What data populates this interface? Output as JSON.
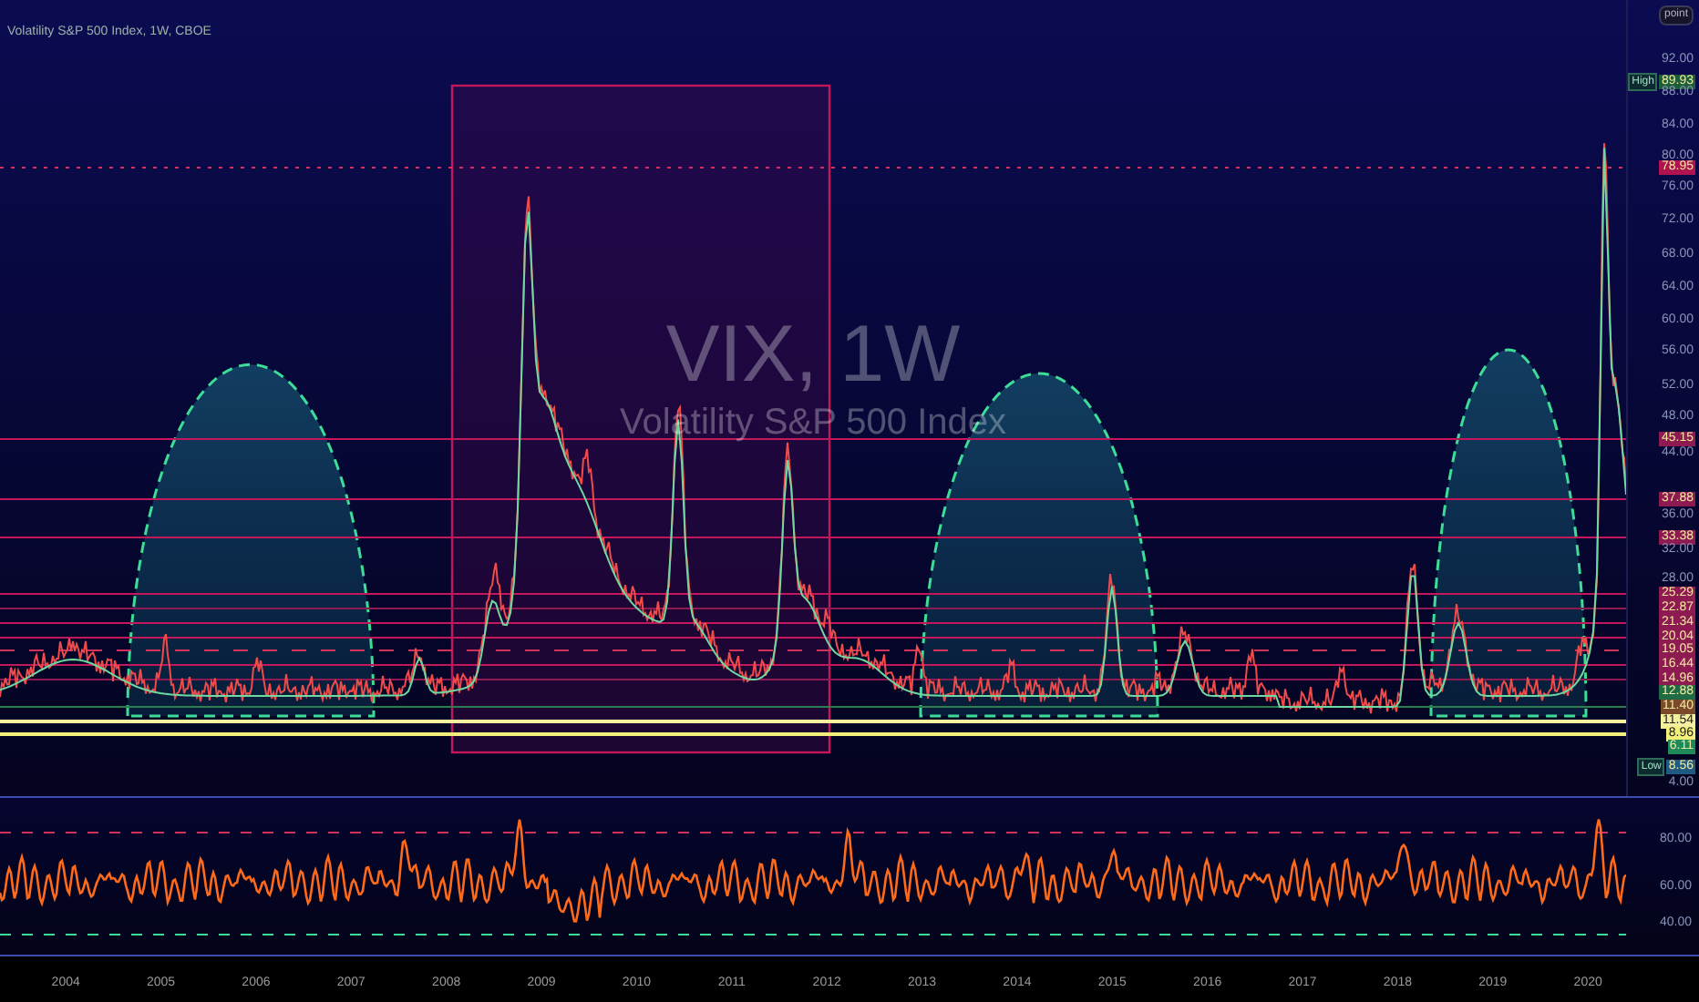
{
  "header": {
    "title": "Volatility S&P 500 Index, 1W, CBOE",
    "button": "point"
  },
  "watermark": {
    "symbol": "VIX, 1W",
    "name": "Volatility S&P 500 Index"
  },
  "price_axis": {
    "labels": [
      {
        "text": "92.00",
        "kind": "tick"
      },
      {
        "text": "89.93",
        "kind": "badge",
        "name": "High",
        "color": "#1b5e3a"
      },
      {
        "text": "88.00",
        "kind": "tick"
      },
      {
        "text": "84.00",
        "kind": "tick"
      },
      {
        "text": "80.00",
        "kind": "tick"
      },
      {
        "text": "78.95",
        "kind": "badge",
        "color": "#b0134f"
      },
      {
        "text": "76.00",
        "kind": "tick"
      },
      {
        "text": "72.00",
        "kind": "tick"
      },
      {
        "text": "68.00",
        "kind": "tick"
      },
      {
        "text": "64.00",
        "kind": "tick"
      },
      {
        "text": "60.00",
        "kind": "tick"
      },
      {
        "text": "56.00",
        "kind": "tick"
      },
      {
        "text": "52.00",
        "kind": "tick"
      },
      {
        "text": "48.00",
        "kind": "tick"
      },
      {
        "text": "45.15",
        "kind": "badge",
        "color": "#8e1a52"
      },
      {
        "text": "44.00",
        "kind": "tick"
      },
      {
        "text": "37.88",
        "kind": "badge",
        "color": "#8e1a52"
      },
      {
        "text": "36.00",
        "kind": "tick"
      },
      {
        "text": "33.38",
        "kind": "badge",
        "color": "#8e1a52"
      },
      {
        "text": "32.00",
        "kind": "tick"
      },
      {
        "text": "28.00",
        "kind": "tick"
      },
      {
        "text": "25.29",
        "kind": "badge",
        "color": "#8e1a52"
      },
      {
        "text": "22.87",
        "kind": "badge",
        "color": "#8e1a52"
      },
      {
        "text": "21.34",
        "kind": "badge",
        "color": "#8e1a52"
      },
      {
        "text": "20.04",
        "kind": "badge",
        "color": "#8e1a52"
      },
      {
        "text": "19.05",
        "kind": "badge",
        "color": "#8e1a52"
      },
      {
        "text": "16.44",
        "kind": "badge",
        "color": "#8e1a52"
      },
      {
        "text": "14.96",
        "kind": "badge",
        "color": "#8e1a52"
      },
      {
        "text": "12.88",
        "kind": "badge",
        "color": "#1f6b45"
      },
      {
        "text": "11.40",
        "kind": "badge",
        "color": "#7a4a2a"
      },
      {
        "text": "11.54",
        "kind": "badge_pale",
        "color": "#f5f0a0"
      },
      {
        "text": "8.96",
        "kind": "badge_pale",
        "color": "#f2ef7a"
      },
      {
        "text": "6.11",
        "kind": "badge",
        "color": "#1e8a5a"
      },
      {
        "text": "8.56",
        "kind": "badge",
        "name": "Low",
        "color": "#1f5a80"
      },
      {
        "text": "4.00",
        "kind": "tick"
      }
    ]
  },
  "indicator_axis": {
    "labels": [
      "80.00",
      "60.00",
      "40.00"
    ]
  },
  "time_axis": {
    "labels": [
      "2004",
      "2005",
      "2006",
      "2007",
      "2008",
      "2009",
      "2010",
      "2011",
      "2012",
      "2013",
      "2014",
      "2015",
      "2016",
      "2017",
      "2018",
      "2019",
      "2020"
    ]
  }
}
